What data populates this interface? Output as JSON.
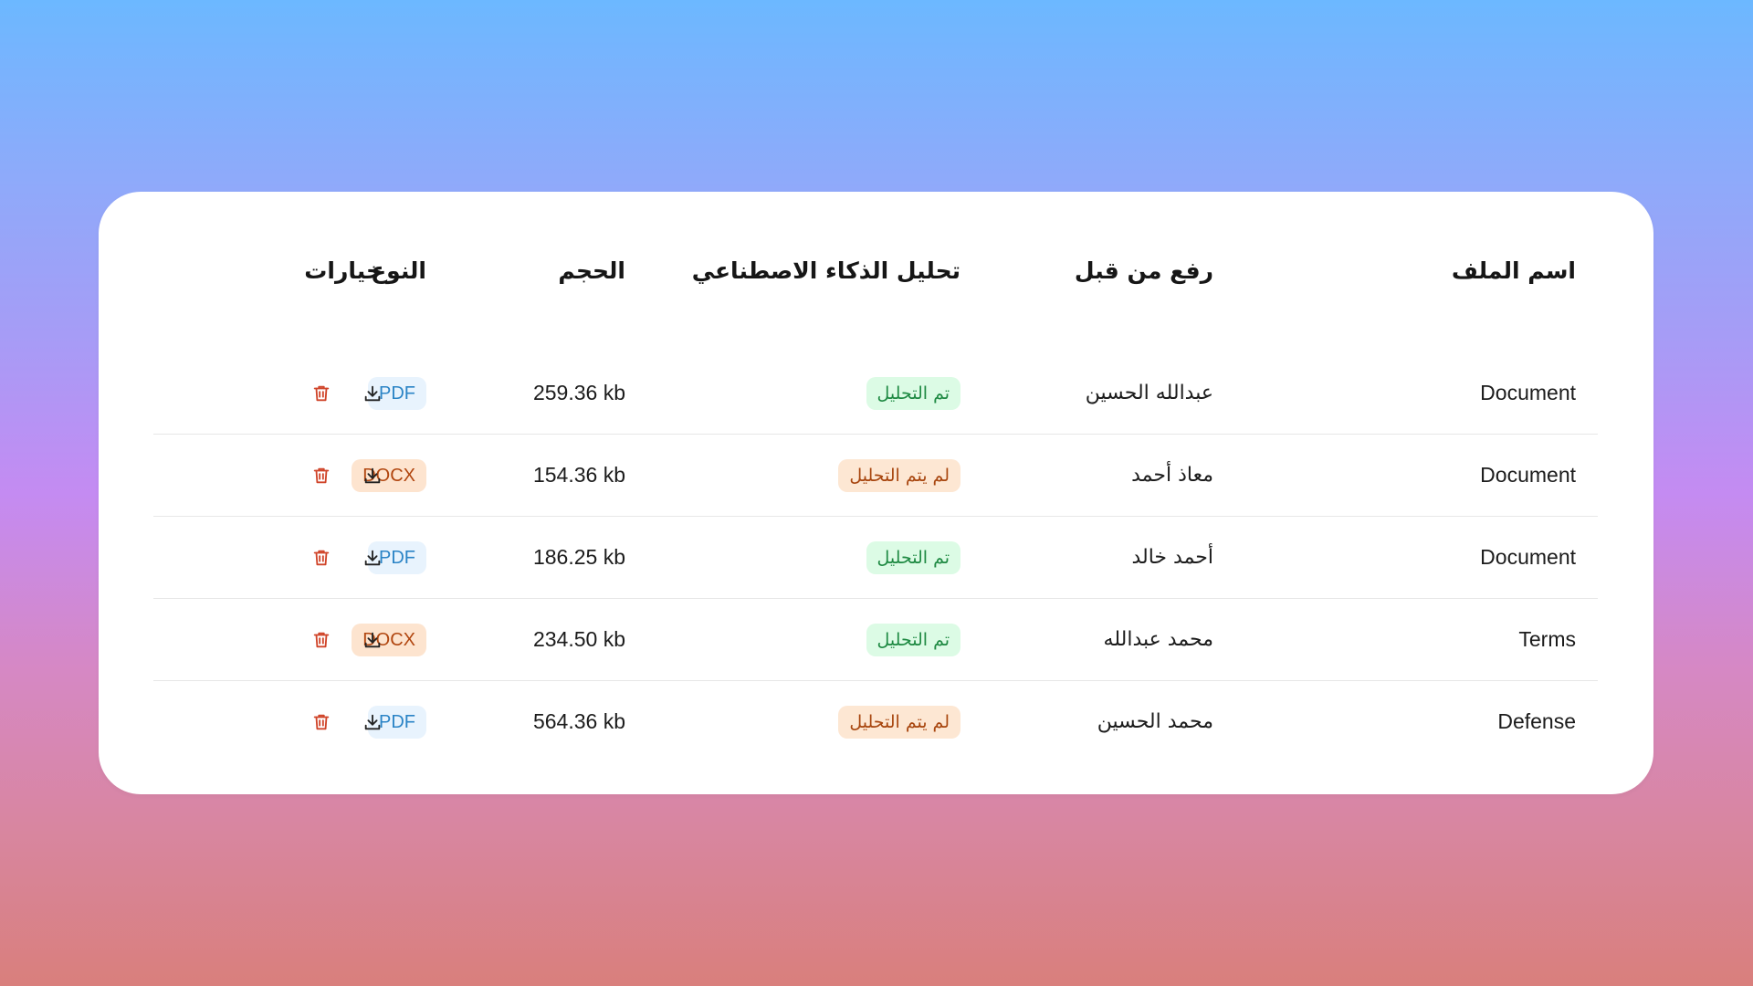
{
  "table": {
    "headers": {
      "file_name": "اسم الملف",
      "uploaded_by": "رفع من قبل",
      "ai_analysis": "تحليل الذكاء الاصطناعي",
      "size": "الحجم",
      "type": "النوع",
      "options": "خيارات"
    },
    "rows": [
      {
        "file_name": "Document",
        "uploaded_by": "عبدالله الحسين",
        "ai_status": "تم التحليل",
        "ai_state": "done",
        "size": "259.36 kb",
        "type": "PDF"
      },
      {
        "file_name": "Document",
        "uploaded_by": "معاذ أحمد",
        "ai_status": "لم يتم التحليل",
        "ai_state": "pending",
        "size": "154.36 kb",
        "type": "DOCX"
      },
      {
        "file_name": "Document",
        "uploaded_by": "أحمد خالد",
        "ai_status": "تم التحليل",
        "ai_state": "done",
        "size": "186.25 kb",
        "type": "PDF"
      },
      {
        "file_name": "Terms",
        "uploaded_by": "محمد عبدالله",
        "ai_status": "تم التحليل",
        "ai_state": "done",
        "size": "234.50 kb",
        "type": "DOCX"
      },
      {
        "file_name": "Defense",
        "uploaded_by": "محمد الحسين",
        "ai_status": "لم يتم التحليل",
        "ai_state": "pending",
        "size": "564.36 kb",
        "type": "PDF"
      }
    ],
    "row_actions": [
      "download-icon",
      "trash-icon"
    ]
  },
  "colors": {
    "analyzed": "#1f8a43",
    "not_analyzed": "#a8460f",
    "pdf": "#2b84c6",
    "docx": "#b1460f",
    "delete": "#d0452a"
  }
}
